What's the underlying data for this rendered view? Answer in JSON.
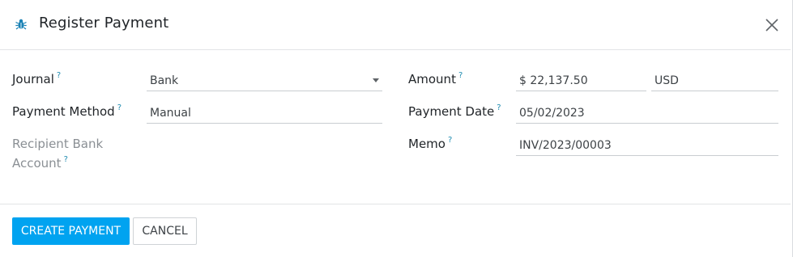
{
  "dialog": {
    "title": "Register Payment",
    "icons": {
      "debug": "bug-icon",
      "close": "close-icon"
    }
  },
  "help_mark": "?",
  "fields": {
    "journal": {
      "label": "Journal",
      "value": "Bank"
    },
    "payment_method": {
      "label": "Payment Method",
      "value": "Manual"
    },
    "recipient_bank_account": {
      "label_line1": "Recipient Bank",
      "label_line2": "Account",
      "value": ""
    },
    "amount": {
      "label": "Amount",
      "value": "$ 22,137.50",
      "currency": "USD"
    },
    "payment_date": {
      "label": "Payment Date",
      "value": "05/02/2023"
    },
    "memo": {
      "label": "Memo",
      "value": "INV/2023/00003"
    }
  },
  "footer": {
    "create_label": "CREATE PAYMENT",
    "cancel_label": "CANCEL"
  },
  "colors": {
    "primary": "#00a3f0",
    "help": "#1e8bb0",
    "muted_label": "#8a8f94"
  }
}
